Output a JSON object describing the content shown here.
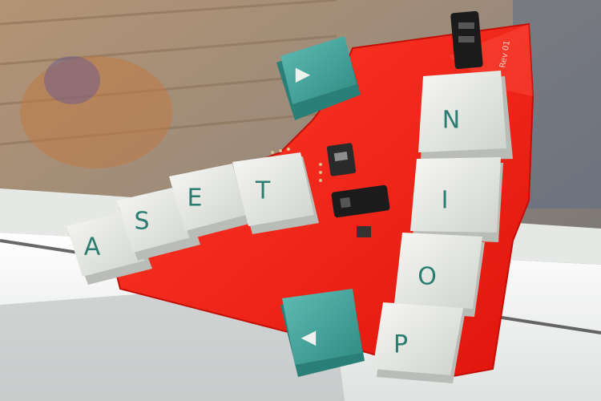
{
  "scene": {
    "description_title": "",
    "board": {
      "revision_label": "Rev 01",
      "color": "#ff2418"
    },
    "keys_left_row": [
      {
        "legend": "A"
      },
      {
        "legend": "S"
      },
      {
        "legend": "E"
      },
      {
        "legend": "T"
      }
    ],
    "keys_right_column": [
      {
        "legend": "N"
      },
      {
        "legend": "I"
      },
      {
        "legend": "O"
      },
      {
        "legend": "P"
      }
    ],
    "arrow_keys": [
      {
        "legend": "▶"
      },
      {
        "legend": "◀"
      }
    ],
    "colors": {
      "keycap_white": "#e9ebe6",
      "keycap_teal": "#4aa8a0",
      "legend_teal": "#2b7d72",
      "window_frame": "#f2f3f1",
      "background_wood": "#b89a7a"
    }
  }
}
